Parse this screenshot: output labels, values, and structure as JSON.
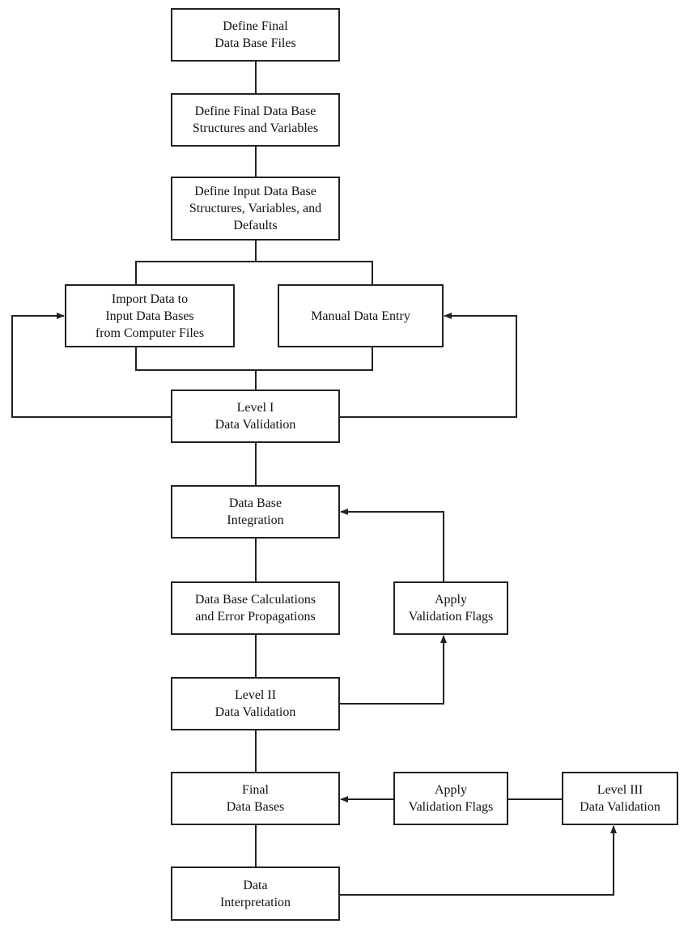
{
  "nodes": {
    "define_final_files": "Define Final\nData Base Files",
    "define_final_structures": "Define Final Data Base\nStructures and Variables",
    "define_input_structures": "Define Input Data Base\nStructures, Variables, and\nDefaults",
    "import_data": "Import Data to\nInput Data Bases\nfrom Computer Files",
    "manual_entry": "Manual Data Entry\n ",
    "level1": "Level I\nData Validation",
    "integration": "Data Base\nIntegration",
    "calculations": "Data Base Calculations\nand Error Propagations",
    "apply_flags_1": "Apply\nValidation Flags",
    "level2": "Level II\nData Validation",
    "final_bases": "Final\nData Bases",
    "apply_flags_2": "Apply\nValidation Flags",
    "level3": "Level III\nData Validation",
    "interpretation": "Data\nInterpretation"
  },
  "colors": {
    "line": "#222222",
    "background": "#ffffff"
  }
}
